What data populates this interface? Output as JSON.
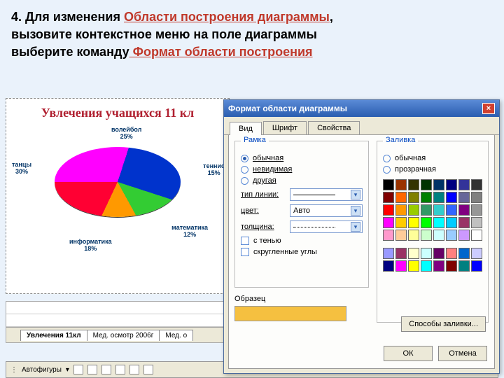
{
  "instr": {
    "lead": "4. Для изменения ",
    "hl1": "Области построения диаграммы",
    "tail1": ",",
    "line2": " вызовите контекстное меню на поле диаграммы",
    "line3a": "выберите команду",
    "hl2": " Формат области построения"
  },
  "chart_data": {
    "type": "pie",
    "title": "Увлечения учащихся 11 кл",
    "series": [
      {
        "name": "Увлечения",
        "values": [
          {
            "label": "танцы",
            "pct": 30,
            "color": "#ff00ff"
          },
          {
            "label": "волейбол",
            "pct": 25,
            "color": "#0033cc"
          },
          {
            "label": "теннис",
            "pct": 15,
            "color": "#33cc33"
          },
          {
            "label": "математика",
            "pct": 12,
            "color": "#ff9900"
          },
          {
            "label": "информатика",
            "pct": 18,
            "color": "#ff0033"
          }
        ]
      }
    ],
    "labels": {
      "dance": "танцы",
      "dance_pct": "30%",
      "volley": "волейбол",
      "volley_pct": "25%",
      "tennis": "теннис",
      "tennis_pct": "15%",
      "math": "математика",
      "math_pct": "12%",
      "info": "информатика",
      "info_pct": "18%"
    }
  },
  "sheet": {
    "tab1": "Увлечения 11кл",
    "tab2": "Мед. осмотр 2006г",
    "tab3": "Мед. о"
  },
  "draw": {
    "label": "Автофигуры"
  },
  "dialog": {
    "title": "Формат области диаграммы",
    "tabs": {
      "view": "Вид",
      "font": "Шрифт",
      "props": "Свойства"
    },
    "frame": {
      "title": "Рамка",
      "normal": "обычная",
      "invisible": "невидимая",
      "other": "другая",
      "linetype": "тип линии:",
      "color": "цвет:",
      "color_val": "Авто",
      "weight": "толщина:",
      "shadow": "с тенью",
      "rounded": "скругленные углы"
    },
    "fill": {
      "title": "Заливка",
      "normal": "обычная",
      "transparent": "прозрачная",
      "methods": "Способы заливки..."
    },
    "sample": "Образец",
    "ok": "ОК",
    "cancel": "Отмена",
    "palette": [
      "#000000",
      "#993300",
      "#333300",
      "#003300",
      "#003366",
      "#000080",
      "#333399",
      "#333333",
      "#800000",
      "#ff6600",
      "#808000",
      "#008000",
      "#008080",
      "#0000ff",
      "#666699",
      "#808080",
      "#ff0000",
      "#ff9900",
      "#99cc00",
      "#339966",
      "#33cccc",
      "#3366ff",
      "#800080",
      "#969696",
      "#ff00ff",
      "#ffcc00",
      "#ffff00",
      "#00ff00",
      "#00ffff",
      "#00ccff",
      "#993366",
      "#c0c0c0",
      "#ff99cc",
      "#ffcc99",
      "#ffff99",
      "#ccffcc",
      "#ccffff",
      "#99ccff",
      "#cc99ff",
      "#ffffff"
    ],
    "palette2": [
      "#9999ff",
      "#993366",
      "#ffffcc",
      "#ccffff",
      "#660066",
      "#ff8080",
      "#0066cc",
      "#ccccff",
      "#000080",
      "#ff00ff",
      "#ffff00",
      "#00ffff",
      "#800080",
      "#800000",
      "#008080",
      "#0000ff"
    ]
  }
}
